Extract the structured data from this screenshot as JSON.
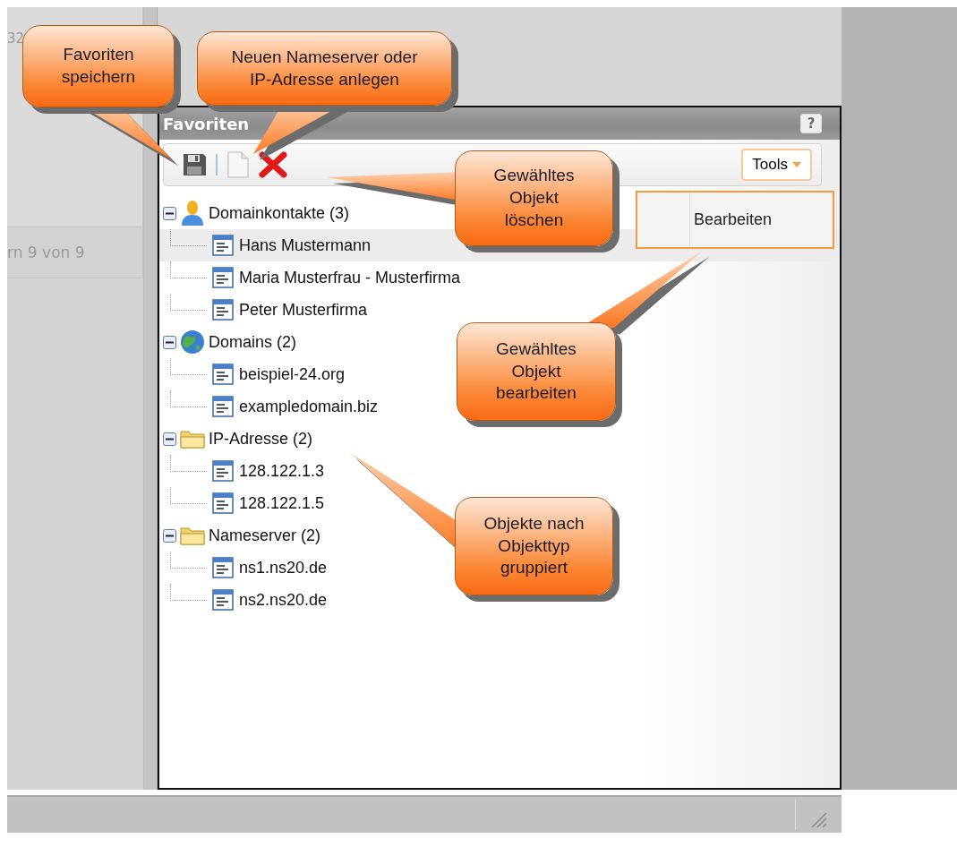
{
  "left_panel": {
    "top_text": "32",
    "footer_text": "rn 9 von 9"
  },
  "panel": {
    "title": "Favoriten",
    "help": "?",
    "tools_button": "Tools",
    "menu": [
      {
        "label": "Bearbeiten"
      }
    ],
    "tree": [
      {
        "label": "Domainkontakte (3)",
        "kind": "contacts",
        "expanded": true,
        "children": [
          {
            "label": "Hans Mustermann",
            "selected": true
          },
          {
            "label": "Maria Musterfrau - Musterfirma",
            "selected": false
          },
          {
            "label": "Peter Musterfirma",
            "selected": false
          }
        ]
      },
      {
        "label": "Domains (2)",
        "kind": "domains",
        "expanded": true,
        "children": [
          {
            "label": "beispiel-24.org",
            "selected": false
          },
          {
            "label": "exampledomain.biz",
            "selected": false
          }
        ]
      },
      {
        "label": "IP-Adresse (2)",
        "kind": "folder",
        "expanded": true,
        "children": [
          {
            "label": "128.122.1.3",
            "selected": false
          },
          {
            "label": "128.122.1.5",
            "selected": false
          }
        ]
      },
      {
        "label": "Nameserver (2)",
        "kind": "folder",
        "expanded": true,
        "children": [
          {
            "label": "ns1.ns20.de",
            "selected": false
          },
          {
            "label": "ns2.ns20.de",
            "selected": false
          }
        ]
      }
    ]
  },
  "callouts": [
    {
      "text": "Favoriten\nspeichern"
    },
    {
      "text": "Neuen Nameserver oder\nIP-Adresse anlegen"
    },
    {
      "text": "Gewähltes\nObjekt\nlöschen"
    },
    {
      "text": "Gewähltes\nObjekt\nbearbeiten"
    },
    {
      "text": "Objekte nach\nObjekttyp\ngruppiert"
    }
  ]
}
